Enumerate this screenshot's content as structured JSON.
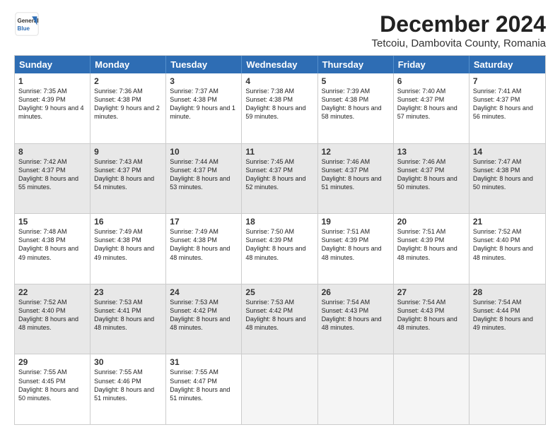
{
  "logo": {
    "line1": "General",
    "line2": "Blue"
  },
  "title": "December 2024",
  "subtitle": "Tetcoiu, Dambovita County, Romania",
  "days": [
    "Sunday",
    "Monday",
    "Tuesday",
    "Wednesday",
    "Thursday",
    "Friday",
    "Saturday"
  ],
  "weeks": [
    [
      {
        "day": "1",
        "rise": "7:35 AM",
        "set": "4:39 PM",
        "daylight": "9 hours and 4 minutes."
      },
      {
        "day": "2",
        "rise": "7:36 AM",
        "set": "4:38 PM",
        "daylight": "9 hours and 2 minutes."
      },
      {
        "day": "3",
        "rise": "7:37 AM",
        "set": "4:38 PM",
        "daylight": "9 hours and 1 minute."
      },
      {
        "day": "4",
        "rise": "7:38 AM",
        "set": "4:38 PM",
        "daylight": "8 hours and 59 minutes."
      },
      {
        "day": "5",
        "rise": "7:39 AM",
        "set": "4:38 PM",
        "daylight": "8 hours and 58 minutes."
      },
      {
        "day": "6",
        "rise": "7:40 AM",
        "set": "4:37 PM",
        "daylight": "8 hours and 57 minutes."
      },
      {
        "day": "7",
        "rise": "7:41 AM",
        "set": "4:37 PM",
        "daylight": "8 hours and 56 minutes."
      }
    ],
    [
      {
        "day": "8",
        "rise": "7:42 AM",
        "set": "4:37 PM",
        "daylight": "8 hours and 55 minutes."
      },
      {
        "day": "9",
        "rise": "7:43 AM",
        "set": "4:37 PM",
        "daylight": "8 hours and 54 minutes."
      },
      {
        "day": "10",
        "rise": "7:44 AM",
        "set": "4:37 PM",
        "daylight": "8 hours and 53 minutes."
      },
      {
        "day": "11",
        "rise": "7:45 AM",
        "set": "4:37 PM",
        "daylight": "8 hours and 52 minutes."
      },
      {
        "day": "12",
        "rise": "7:46 AM",
        "set": "4:37 PM",
        "daylight": "8 hours and 51 minutes."
      },
      {
        "day": "13",
        "rise": "7:46 AM",
        "set": "4:37 PM",
        "daylight": "8 hours and 50 minutes."
      },
      {
        "day": "14",
        "rise": "7:47 AM",
        "set": "4:38 PM",
        "daylight": "8 hours and 50 minutes."
      }
    ],
    [
      {
        "day": "15",
        "rise": "7:48 AM",
        "set": "4:38 PM",
        "daylight": "8 hours and 49 minutes."
      },
      {
        "day": "16",
        "rise": "7:49 AM",
        "set": "4:38 PM",
        "daylight": "8 hours and 49 minutes."
      },
      {
        "day": "17",
        "rise": "7:49 AM",
        "set": "4:38 PM",
        "daylight": "8 hours and 48 minutes."
      },
      {
        "day": "18",
        "rise": "7:50 AM",
        "set": "4:39 PM",
        "daylight": "8 hours and 48 minutes."
      },
      {
        "day": "19",
        "rise": "7:51 AM",
        "set": "4:39 PM",
        "daylight": "8 hours and 48 minutes."
      },
      {
        "day": "20",
        "rise": "7:51 AM",
        "set": "4:39 PM",
        "daylight": "8 hours and 48 minutes."
      },
      {
        "day": "21",
        "rise": "7:52 AM",
        "set": "4:40 PM",
        "daylight": "8 hours and 48 minutes."
      }
    ],
    [
      {
        "day": "22",
        "rise": "7:52 AM",
        "set": "4:40 PM",
        "daylight": "8 hours and 48 minutes."
      },
      {
        "day": "23",
        "rise": "7:53 AM",
        "set": "4:41 PM",
        "daylight": "8 hours and 48 minutes."
      },
      {
        "day": "24",
        "rise": "7:53 AM",
        "set": "4:42 PM",
        "daylight": "8 hours and 48 minutes."
      },
      {
        "day": "25",
        "rise": "7:53 AM",
        "set": "4:42 PM",
        "daylight": "8 hours and 48 minutes."
      },
      {
        "day": "26",
        "rise": "7:54 AM",
        "set": "4:43 PM",
        "daylight": "8 hours and 48 minutes."
      },
      {
        "day": "27",
        "rise": "7:54 AM",
        "set": "4:43 PM",
        "daylight": "8 hours and 48 minutes."
      },
      {
        "day": "28",
        "rise": "7:54 AM",
        "set": "4:44 PM",
        "daylight": "8 hours and 49 minutes."
      }
    ],
    [
      {
        "day": "29",
        "rise": "7:55 AM",
        "set": "4:45 PM",
        "daylight": "8 hours and 50 minutes."
      },
      {
        "day": "30",
        "rise": "7:55 AM",
        "set": "4:46 PM",
        "daylight": "8 hours and 51 minutes."
      },
      {
        "day": "31",
        "rise": "7:55 AM",
        "set": "4:47 PM",
        "daylight": "8 hours and 51 minutes."
      },
      null,
      null,
      null,
      null
    ]
  ]
}
